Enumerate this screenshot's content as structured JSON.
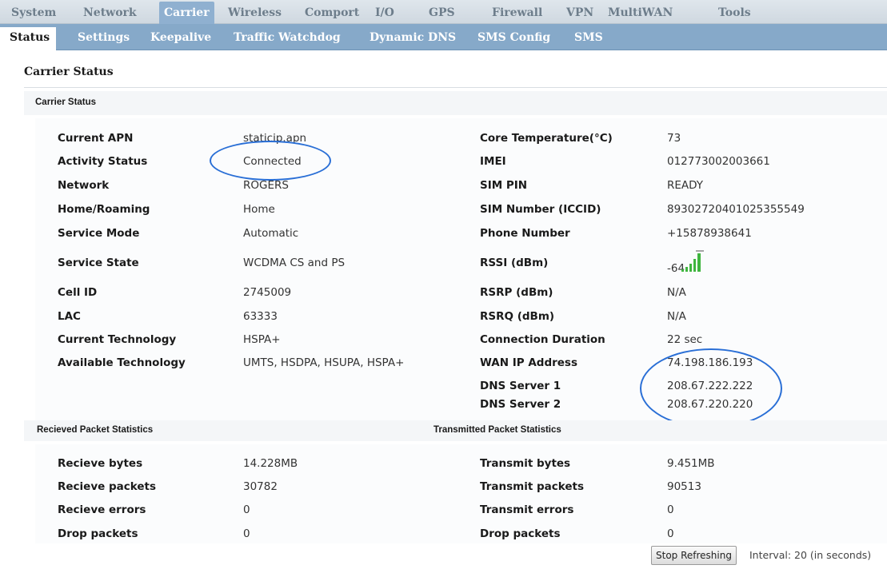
{
  "top_nav": [
    "System",
    "Network",
    "Carrier",
    "Wireless",
    "Comport",
    "I/O",
    "GPS",
    "Firewall",
    "VPN",
    "MultiWAN",
    "Tools"
  ],
  "sub_nav": [
    "Status",
    "Settings",
    "Keepalive",
    "Traffic Watchdog",
    "Dynamic DNS",
    "SMS Config",
    "SMS"
  ],
  "page_title": "Carrier Status",
  "section_title": "Carrier Status",
  "left_fields": [
    {
      "label": "Current APN",
      "value": "staticip.apn"
    },
    {
      "label": "Activity Status",
      "value": "Connected"
    },
    {
      "label": "Network",
      "value": "ROGERS"
    },
    {
      "label": "Home/Roaming",
      "value": "Home"
    },
    {
      "label": "Service Mode",
      "value": "Automatic"
    },
    {
      "label": "Service State",
      "value": "WCDMA CS and PS"
    },
    {
      "label": "Cell ID",
      "value": "2745009"
    },
    {
      "label": "LAC",
      "value": "63333"
    },
    {
      "label": "Current Technology",
      "value": "HSPA+"
    },
    {
      "label": "Available Technology",
      "value": "UMTS, HSDPA, HSUPA, HSPA+"
    }
  ],
  "right_fields": [
    {
      "label": "Core Temperature(°C)",
      "value": "73"
    },
    {
      "label": "IMEI",
      "value": "012773002003661"
    },
    {
      "label": "SIM PIN",
      "value": "READY"
    },
    {
      "label": "SIM Number (ICCID)",
      "value": "89302720401025355549"
    },
    {
      "label": "Phone Number",
      "value": "+15878938641"
    },
    {
      "label": "RSSI (dBm)",
      "value": "-64"
    },
    {
      "label": "RSRP (dBm)",
      "value": "N/A"
    },
    {
      "label": "RSRQ (dBm)",
      "value": "N/A"
    },
    {
      "label": "Connection Duration",
      "value": "22 sec"
    },
    {
      "label": "WAN IP Address",
      "value": "74.198.186.193"
    },
    {
      "label": "DNS Server 1",
      "value": "208.67.222.222"
    },
    {
      "label": "DNS Server 2",
      "value": "208.67.220.220"
    }
  ],
  "received_title": "Recieved Packet Statistics",
  "transmitted_title": "Transmitted Packet Statistics",
  "received": [
    {
      "label": "Recieve bytes",
      "value": "14.228MB"
    },
    {
      "label": "Recieve packets",
      "value": "30782"
    },
    {
      "label": "Recieve errors",
      "value": "0"
    },
    {
      "label": "Drop packets",
      "value": "0"
    }
  ],
  "transmitted": [
    {
      "label": "Transmit bytes",
      "value": "9.451MB"
    },
    {
      "label": "Transmit packets",
      "value": "90513"
    },
    {
      "label": "Transmit errors",
      "value": "0"
    },
    {
      "label": "Drop packets",
      "value": "0"
    }
  ],
  "signal_icon": "signal-strength-icon",
  "signal_bars": 5,
  "stop_button": "Stop Refreshing",
  "interval_text": "Interval: 20 (in seconds)",
  "colors": {
    "highlight_ring": "#2a6fd6",
    "nav_active": "#8fb0d0",
    "subnav_bg": "#86a9c9",
    "signal": "#3fb53f"
  }
}
